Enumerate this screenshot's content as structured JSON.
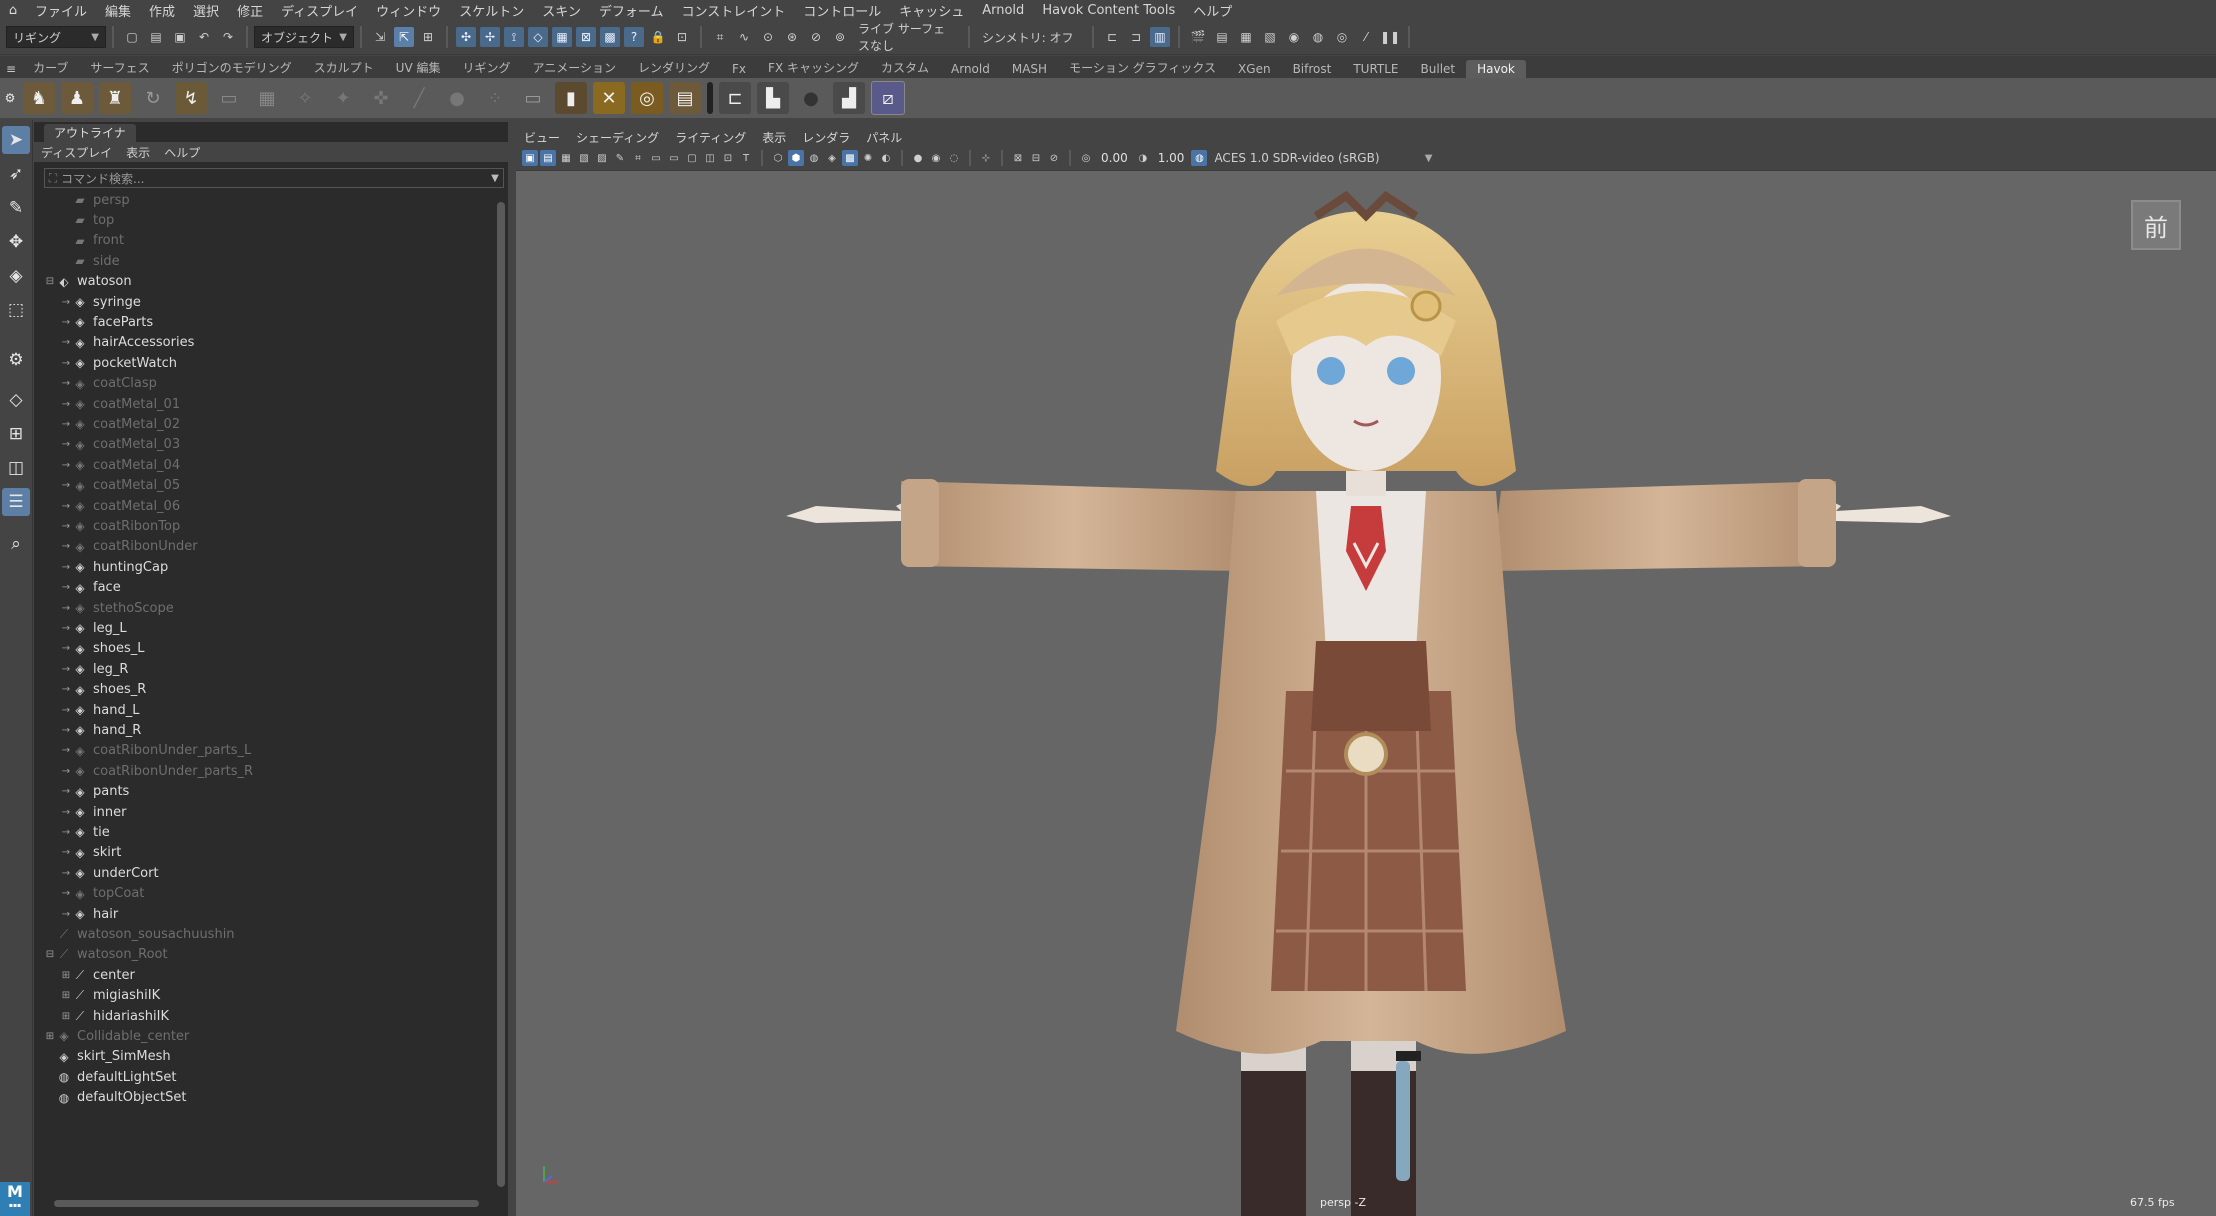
{
  "menubar": {
    "items": [
      "ファイル",
      "編集",
      "作成",
      "選択",
      "修正",
      "ディスプレイ",
      "ウィンドウ",
      "スケルトン",
      "スキン",
      "デフォーム",
      "コンストレイント",
      "コントロール",
      "キャッシュ",
      "Arnold",
      "Havok Content Tools",
      "ヘルプ"
    ]
  },
  "statusline": {
    "menuset": "リギング",
    "selection_mode": "オブジェクト",
    "live_surface": "ライブ サーフェスなし",
    "symmetry": "シンメトリ: オフ"
  },
  "shelf_tabs": [
    "カーブ",
    "サーフェス",
    "ポリゴンのモデリング",
    "スカルプト",
    "UV 編集",
    "リギング",
    "アニメーション",
    "レンダリング",
    "Fx",
    "FX キャッシング",
    "カスタム",
    "Arnold",
    "MASH",
    "モーション グラフィックス",
    "XGen",
    "Bifrost",
    "TURTLE",
    "Bullet",
    "Havok"
  ],
  "shelf_active_tab": "Havok",
  "outliner": {
    "tab": "アウトライナ",
    "menu": [
      "ディスプレイ",
      "表示",
      "ヘルプ"
    ],
    "search_placeholder": "コマンド検索...",
    "items": [
      {
        "label": "persp",
        "dim": true,
        "indent": 1,
        "icon": "camera-icon",
        "exp": ""
      },
      {
        "label": "top",
        "dim": true,
        "indent": 1,
        "icon": "camera-icon",
        "exp": ""
      },
      {
        "label": "front",
        "dim": true,
        "indent": 1,
        "icon": "camera-icon",
        "exp": ""
      },
      {
        "label": "side",
        "dim": true,
        "indent": 1,
        "icon": "camera-icon",
        "exp": ""
      },
      {
        "label": "watoson",
        "dim": false,
        "indent": 0,
        "icon": "group-icon",
        "exp": "⊟"
      },
      {
        "label": "syringe",
        "dim": false,
        "indent": 1,
        "icon": "mesh-icon",
        "exp": "→"
      },
      {
        "label": "faceParts",
        "dim": false,
        "indent": 1,
        "icon": "mesh-icon",
        "exp": "→"
      },
      {
        "label": "hairAccessories",
        "dim": false,
        "indent": 1,
        "icon": "mesh-icon",
        "exp": "→"
      },
      {
        "label": "pocketWatch",
        "dim": false,
        "indent": 1,
        "icon": "mesh-icon",
        "exp": "→"
      },
      {
        "label": "coatClasp",
        "dim": true,
        "indent": 1,
        "icon": "mesh-icon",
        "exp": "→"
      },
      {
        "label": "coatMetal_01",
        "dim": true,
        "indent": 1,
        "icon": "mesh-icon",
        "exp": "→"
      },
      {
        "label": "coatMetal_02",
        "dim": true,
        "indent": 1,
        "icon": "mesh-icon",
        "exp": "→"
      },
      {
        "label": "coatMetal_03",
        "dim": true,
        "indent": 1,
        "icon": "mesh-icon",
        "exp": "→"
      },
      {
        "label": "coatMetal_04",
        "dim": true,
        "indent": 1,
        "icon": "mesh-icon",
        "exp": "→"
      },
      {
        "label": "coatMetal_05",
        "dim": true,
        "indent": 1,
        "icon": "mesh-icon",
        "exp": "→"
      },
      {
        "label": "coatMetal_06",
        "dim": true,
        "indent": 1,
        "icon": "mesh-icon",
        "exp": "→"
      },
      {
        "label": "coatRibonTop",
        "dim": true,
        "indent": 1,
        "icon": "mesh-icon",
        "exp": "→"
      },
      {
        "label": "coatRibonUnder",
        "dim": true,
        "indent": 1,
        "icon": "mesh-icon",
        "exp": "→"
      },
      {
        "label": "huntingCap",
        "dim": false,
        "indent": 1,
        "icon": "mesh-icon",
        "exp": "→"
      },
      {
        "label": "face",
        "dim": false,
        "indent": 1,
        "icon": "mesh-icon",
        "exp": "→"
      },
      {
        "label": "stethoScope",
        "dim": true,
        "indent": 1,
        "icon": "mesh-icon",
        "exp": "→"
      },
      {
        "label": "leg_L",
        "dim": false,
        "indent": 1,
        "icon": "mesh-icon",
        "exp": "→"
      },
      {
        "label": "shoes_L",
        "dim": false,
        "indent": 1,
        "icon": "mesh-icon",
        "exp": "→"
      },
      {
        "label": "leg_R",
        "dim": false,
        "indent": 1,
        "icon": "mesh-icon",
        "exp": "→"
      },
      {
        "label": "shoes_R",
        "dim": false,
        "indent": 1,
        "icon": "mesh-icon",
        "exp": "→"
      },
      {
        "label": "hand_L",
        "dim": false,
        "indent": 1,
        "icon": "mesh-icon",
        "exp": "→"
      },
      {
        "label": "hand_R",
        "dim": false,
        "indent": 1,
        "icon": "mesh-icon",
        "exp": "→"
      },
      {
        "label": "coatRibonUnder_parts_L",
        "dim": true,
        "indent": 1,
        "icon": "mesh-icon",
        "exp": "→"
      },
      {
        "label": "coatRibonUnder_parts_R",
        "dim": true,
        "indent": 1,
        "icon": "mesh-icon",
        "exp": "→"
      },
      {
        "label": "pants",
        "dim": false,
        "indent": 1,
        "icon": "mesh-icon",
        "exp": "→"
      },
      {
        "label": "inner",
        "dim": false,
        "indent": 1,
        "icon": "mesh-icon",
        "exp": "→"
      },
      {
        "label": "tie",
        "dim": false,
        "indent": 1,
        "icon": "mesh-icon",
        "exp": "→"
      },
      {
        "label": "skirt",
        "dim": false,
        "indent": 1,
        "icon": "mesh-icon",
        "exp": "→"
      },
      {
        "label": "underCort",
        "dim": false,
        "indent": 1,
        "icon": "mesh-icon",
        "exp": "→"
      },
      {
        "label": "topCoat",
        "dim": true,
        "indent": 1,
        "icon": "mesh-icon",
        "exp": "→"
      },
      {
        "label": "hair",
        "dim": false,
        "indent": 1,
        "icon": "mesh-icon",
        "exp": "→"
      },
      {
        "label": "watoson_sousachuushin",
        "dim": true,
        "indent": 0,
        "icon": "joint-icon",
        "exp": ""
      },
      {
        "label": "watoson_Root",
        "dim": true,
        "indent": 0,
        "icon": "joint-icon",
        "exp": "⊟"
      },
      {
        "label": "center",
        "dim": false,
        "indent": 1,
        "icon": "joint-icon",
        "exp": "⊞"
      },
      {
        "label": "migiashiIK",
        "dim": false,
        "indent": 1,
        "icon": "joint-icon",
        "exp": "⊞"
      },
      {
        "label": "hidariashiIK",
        "dim": false,
        "indent": 1,
        "icon": "joint-icon",
        "exp": "⊞"
      },
      {
        "label": "Collidable_center",
        "dim": true,
        "indent": 0,
        "icon": "mesh-icon",
        "exp": "⊞"
      },
      {
        "label": "skirt_SimMesh",
        "dim": false,
        "indent": 0,
        "icon": "mesh-icon",
        "exp": ""
      },
      {
        "label": "defaultLightSet",
        "dim": false,
        "indent": 0,
        "icon": "set-icon",
        "exp": ""
      },
      {
        "label": "defaultObjectSet",
        "dim": false,
        "indent": 0,
        "icon": "set-icon",
        "exp": ""
      }
    ]
  },
  "viewport": {
    "menu": [
      "ビュー",
      "シェーディング",
      "ライティング",
      "表示",
      "レンダラ",
      "パネル"
    ],
    "exposure": "0.00",
    "gamma": "1.00",
    "color_space": "ACES 1.0 SDR-video (sRGB)",
    "view_cube_label": "前",
    "camera_label": "persp -Z",
    "fps": "67.5 fps"
  },
  "colors": {
    "ui_bg": "#444444",
    "outliner_bg": "#2b2b2b",
    "viewport_bg": "#666666",
    "accent": "#5d7fa6"
  },
  "logo": "M"
}
